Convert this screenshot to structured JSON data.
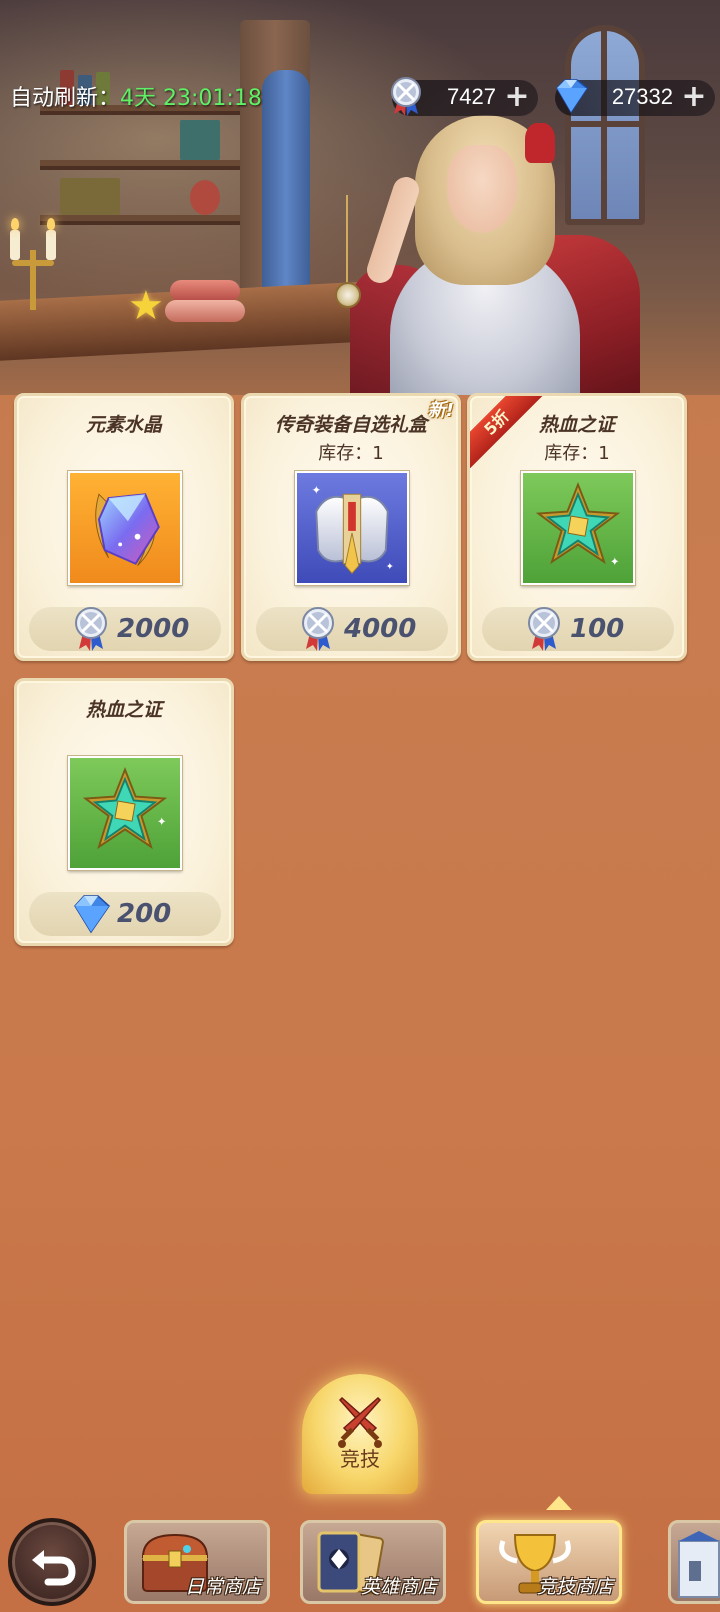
{
  "topbar": {
    "refresh_label": "自动刷新：",
    "refresh_timer": "4天 23:01:18",
    "medal_amount": "7427",
    "gem_amount": "27332",
    "medal_icon": "arena-medal-icon",
    "gem_icon": "diamond-icon"
  },
  "items": [
    {
      "name": "元素水晶",
      "stock": "",
      "price": "2000",
      "currency": "arena-medal-icon",
      "badge": "",
      "icon": "element-crystal-icon"
    },
    {
      "name": "传奇装备自选礼盒",
      "stock": "库存：1",
      "price": "4000",
      "currency": "arena-medal-icon",
      "badge": "新!",
      "icon": "legendary-armor-box-icon"
    },
    {
      "name": "热血之证",
      "stock": "库存：1",
      "price": "100",
      "currency": "arena-medal-icon",
      "badge": "5折",
      "icon": "hot-blood-proof-icon"
    },
    {
      "name": "热血之证",
      "stock": "",
      "price": "200",
      "currency": "diamond-icon",
      "badge": "",
      "icon": "hot-blood-proof-icon"
    }
  ],
  "nav": {
    "arena_label": "竞技",
    "tabs": [
      {
        "label": "日常商店",
        "icon": "treasure-chest-icon"
      },
      {
        "label": "英雄商店",
        "icon": "hero-card-icon"
      },
      {
        "label": "竞技商店",
        "icon": "trophy-icon",
        "active": true
      },
      {
        "label": "",
        "icon": "castle-icon"
      }
    ],
    "back_icon": "back-arrow-icon"
  },
  "colors": {
    "timer_green": "#5ff065",
    "price_text": "#4a5270",
    "card_bg": "#fbf2dc",
    "page_bg": "#c87c4f",
    "sale_ribbon": "#d8372a"
  }
}
